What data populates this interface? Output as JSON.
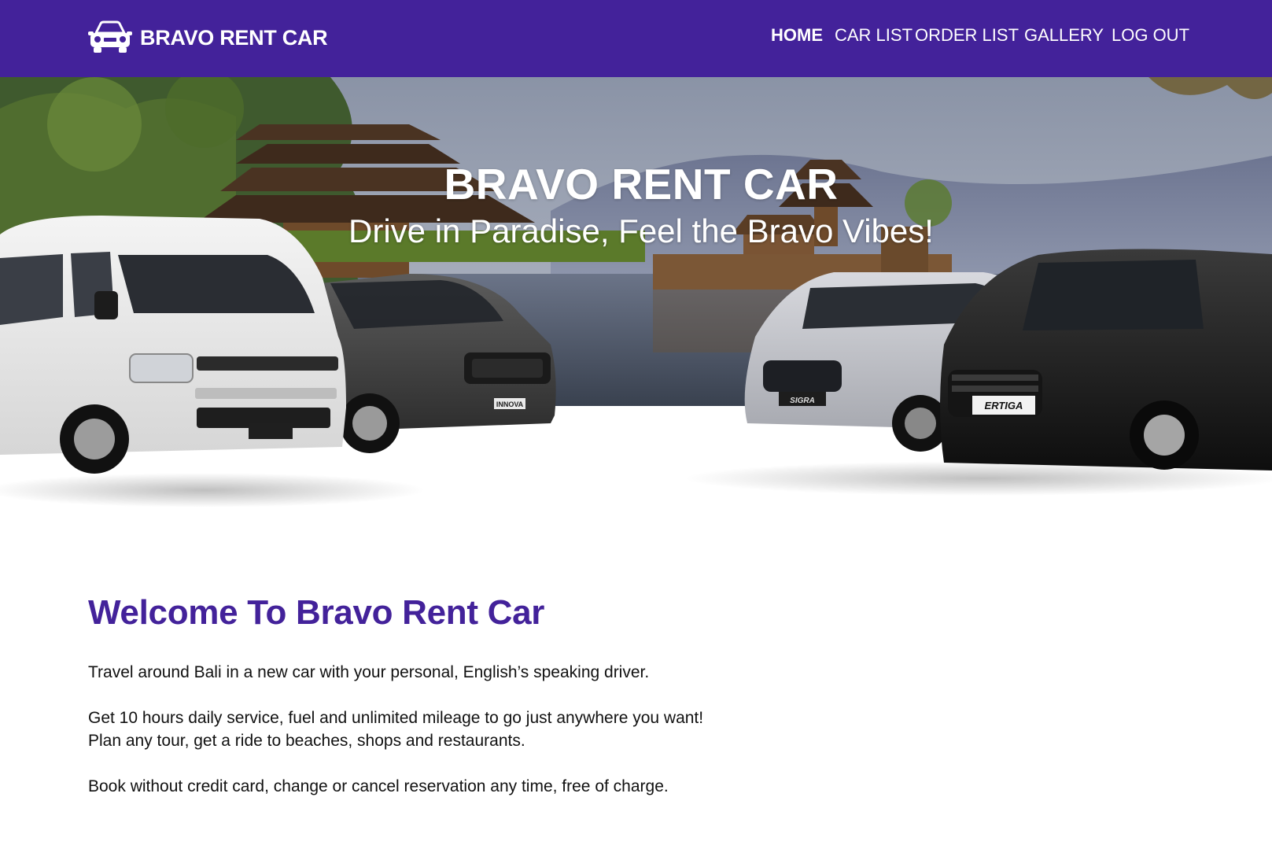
{
  "brand": {
    "name": "BRAVO RENT CAR",
    "icon": "car-icon"
  },
  "nav": {
    "home": "HOME",
    "car_list": "CAR LIST",
    "order_list": "ORDER LIST",
    "gallery": "GALLERY",
    "logout": "LOG OUT",
    "active": "HOME"
  },
  "hero": {
    "title": "BRAVO RENT CAR",
    "subtitle": "Drive in Paradise, Feel the Bravo Vibes!",
    "car_badges": [
      "ERTIGA",
      "SIGRA",
      "INNOVA"
    ]
  },
  "welcome": {
    "heading": "Welcome To Bravo Rent Car",
    "paragraph_1": "Travel around Bali in a new car with your personal, English’s speaking driver.",
    "paragraph_2_line_1": "Get 10 hours daily service, fuel and unlimited mileage to go just anywhere you want!",
    "paragraph_2_line_2": "Plan any tour, get a ride to beaches, shops and restaurants.",
    "paragraph_3": "Book without credit card, change or cancel reservation any time, free of charge."
  },
  "colors": {
    "brand_purple": "#43229a",
    "text": "#111111",
    "background": "#ffffff"
  }
}
